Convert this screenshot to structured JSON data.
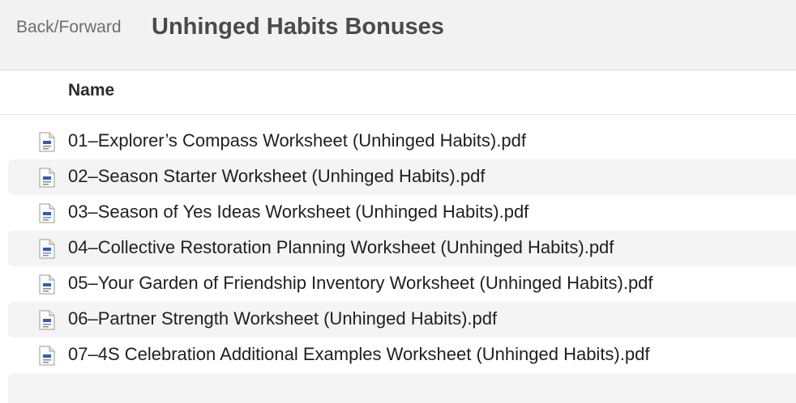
{
  "toolbar": {
    "nav_label": "Back/Forward",
    "title": "Unhinged Habits Bonuses"
  },
  "table": {
    "columns": [
      "Name"
    ]
  },
  "files": [
    {
      "name": "01–Explorer’s Compass Worksheet (Unhinged Habits).pdf",
      "icon": "pdf-file-icon"
    },
    {
      "name": "02–Season Starter Worksheet (Unhinged Habits).pdf",
      "icon": "pdf-file-icon"
    },
    {
      "name": "03–Season of Yes Ideas Worksheet (Unhinged Habits).pdf",
      "icon": "pdf-file-icon"
    },
    {
      "name": "04–Collective Restoration Planning Worksheet (Unhinged Habits).pdf",
      "icon": "pdf-file-icon"
    },
    {
      "name": "05–Your Garden of Friendship Inventory Worksheet (Unhinged Habits).pdf",
      "icon": "pdf-file-icon"
    },
    {
      "name": "06–Partner Strength Worksheet (Unhinged Habits).pdf",
      "icon": "pdf-file-icon"
    },
    {
      "name": "07–4S Celebration Additional Examples Worksheet (Unhinged Habits).pdf",
      "icon": "pdf-file-icon"
    }
  ],
  "colors": {
    "toolbar_bg": "#f2f2f2",
    "stripe_bg": "#f4f4f4",
    "icon_accent": "#2f5fb3"
  }
}
